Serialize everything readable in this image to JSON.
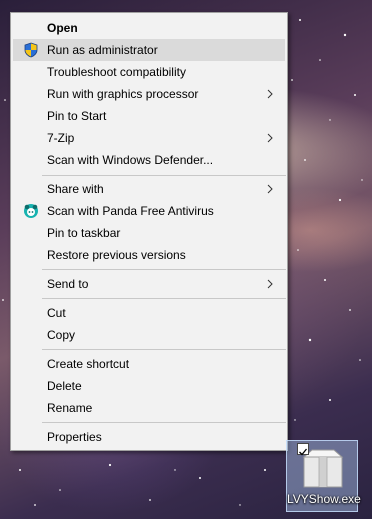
{
  "context_menu": {
    "items": [
      {
        "label": "Open"
      },
      {
        "label": "Run as administrator"
      },
      {
        "label": "Troubleshoot compatibility"
      },
      {
        "label": "Run with graphics processor"
      },
      {
        "label": "Pin to Start"
      },
      {
        "label": "7-Zip"
      },
      {
        "label": "Scan with Windows Defender..."
      },
      {
        "label": "Share with"
      },
      {
        "label": "Scan with Panda Free Antivirus"
      },
      {
        "label": "Pin to taskbar"
      },
      {
        "label": "Restore previous versions"
      },
      {
        "label": "Send to"
      },
      {
        "label": "Cut"
      },
      {
        "label": "Copy"
      },
      {
        "label": "Create shortcut"
      },
      {
        "label": "Delete"
      },
      {
        "label": "Rename"
      },
      {
        "label": "Properties"
      }
    ],
    "highlighted_item": "Run as administrator",
    "icons": {
      "run_as_administrator": "uac-shield-icon",
      "scan_with_panda": "panda-antivirus-icon",
      "submenu": "chevron-right-icon"
    }
  },
  "desktop": {
    "file": {
      "name": "LVYShow.exe",
      "selected": true,
      "checked": true,
      "icon": "archive-box-icon"
    }
  },
  "colors": {
    "menu_background": "#f2f2f2",
    "menu_hover": "#dadada",
    "separator": "#c8c8c8",
    "selection": "#aac8f0"
  }
}
